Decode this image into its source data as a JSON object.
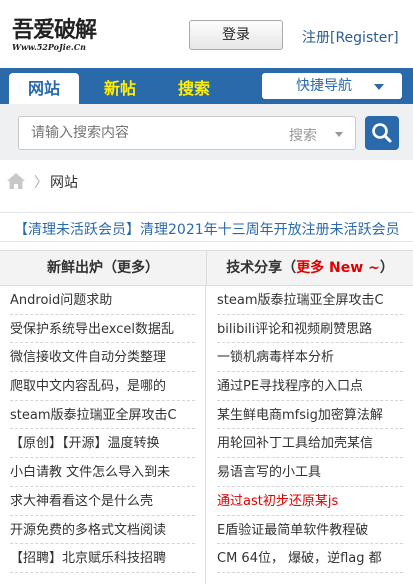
{
  "header": {
    "logo_text": "吾爱破解",
    "logo_url": "Www.52PoJie.Cn",
    "login_label": "登录",
    "register_label": "注册[Register]"
  },
  "nav": {
    "tabs": [
      {
        "label": "网站"
      },
      {
        "label": "新帖"
      },
      {
        "label": "搜索"
      }
    ],
    "quick_nav_label": "快捷导航"
  },
  "search": {
    "placeholder": "请输入搜索内容",
    "type_label": "搜索"
  },
  "breadcrumb": {
    "separator": "〉",
    "current": "网站"
  },
  "notice": {
    "text": "【清理未活跃会员】清理2021年十三周年开放注册未活跃会员"
  },
  "columns": {
    "left": {
      "title": "新鲜出炉（更多）",
      "items": [
        "Android问题求助",
        "受保护系统导出excel数据乱",
        "微信接收文件自动分类整理",
        "爬取中文内容乱码，是哪的",
        "steam版泰拉瑞亚全屏攻击C",
        "【原创】【开源】温度转换",
        "小白请教 文件怎么导入到未",
        "求大神看看这个是什么壳",
        "开源免费的多格式文档阅读",
        "【招聘】北京赋乐科技招聘"
      ]
    },
    "right": {
      "title_prefix": "技术分享（",
      "title_highlight": "更多 New ~",
      "title_suffix": "）",
      "items": [
        {
          "text": "steam版泰拉瑞亚全屏攻击C",
          "red": false
        },
        {
          "text": "bilibili评论和视频刷赞思路",
          "red": false
        },
        {
          "text": "一锁机病毒样本分析",
          "red": false
        },
        {
          "text": "通过PE寻找程序的入口点",
          "red": false
        },
        {
          "text": "某生鲜电商mfsig加密算法解",
          "red": false
        },
        {
          "text": "用轮回补丁工具给加壳某信",
          "red": false
        },
        {
          "text": "易语言写的小工具",
          "red": false
        },
        {
          "text": "通过ast初步还原某js",
          "red": true
        },
        {
          "text": "E盾验证最简单软件教程破",
          "red": false
        },
        {
          "text": "CM 64位， 爆破，逆flag 都",
          "red": false
        }
      ]
    }
  },
  "colors": {
    "brand_blue": "#2b6aaa",
    "nav_highlight": "#ffee00",
    "accent_red": "#e00000"
  }
}
